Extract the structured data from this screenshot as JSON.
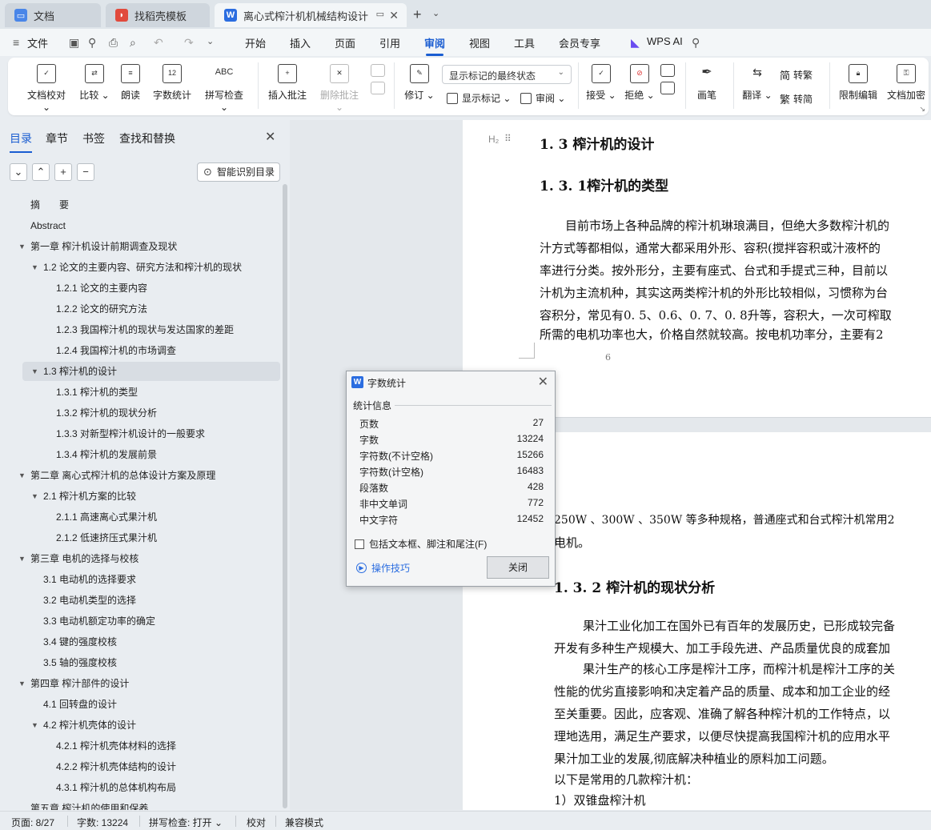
{
  "tabs": [
    {
      "label": "文档",
      "icon": "monitor-icon",
      "active": false
    },
    {
      "label": "找稻壳模板",
      "icon": "docer-icon",
      "active": false
    },
    {
      "label": "离心式榨汁机机械结构设计 说",
      "icon": "wps-word-icon",
      "active": true
    }
  ],
  "menu": {
    "file": "文件",
    "items": [
      "开始",
      "插入",
      "页面",
      "引用",
      "审阅",
      "视图",
      "工具",
      "会员专享"
    ],
    "active": "审阅",
    "wps_ai": "WPS AI"
  },
  "ribbon": {
    "doc_proofread": "文档校对",
    "compare": "比较",
    "read_aloud": "朗读",
    "word_count": "字数统计",
    "spell_check": "拼写检查",
    "insert_comment": "插入批注",
    "delete_comment": "删除批注",
    "revise": "修订",
    "markup_status": "显示标记的最终状态",
    "show_markup": "显示标记",
    "review": "审阅",
    "accept": "接受",
    "reject": "拒绝",
    "pen": "画笔",
    "translate": "翻译",
    "to_traditional": "转繁",
    "to_simplified": "转简",
    "restrict_edit": "限制编辑",
    "doc_encrypt": "文档加密"
  },
  "panel": {
    "tabs": [
      "目录",
      "章节",
      "书签",
      "查找和替换"
    ],
    "active_tab": "目录",
    "smart_toc": "智能识别目录"
  },
  "toc": [
    {
      "text": "摘　　要",
      "level": 1,
      "arrow": false
    },
    {
      "text": "Abstract",
      "level": 1,
      "arrow": false
    },
    {
      "text": "第一章  榨汁机设计前期调查及现状",
      "level": 0,
      "arrow": true
    },
    {
      "text": "1.2 论文的主要内容、研究方法和榨汁机的现状",
      "level": 1.5,
      "arrow": true
    },
    {
      "text": "1.2.1 论文的主要内容",
      "level": 3,
      "arrow": false
    },
    {
      "text": "1.2.2 论文的研究方法",
      "level": 3,
      "arrow": false
    },
    {
      "text": "1.2.3 我国榨汁机的现状与发达国家的差距",
      "level": 3,
      "arrow": false
    },
    {
      "text": "1.2.4 我国榨汁机的市场调查",
      "level": 3,
      "arrow": false
    },
    {
      "text": "1.3  榨汁机的设计",
      "level": 1.5,
      "arrow": true,
      "selected": true
    },
    {
      "text": "1.3.1 榨汁机的类型",
      "level": 3,
      "arrow": false
    },
    {
      "text": "1.3.2  榨汁机的现状分析",
      "level": 3,
      "arrow": false
    },
    {
      "text": "1.3.3 对新型榨汁机设计的一般要求",
      "level": 3,
      "arrow": false
    },
    {
      "text": "1.3.4  榨汁机的发展前景",
      "level": 3,
      "arrow": false
    },
    {
      "text": "第二章  离心式榨汁机的总体设计方案及原理",
      "level": 0,
      "arrow": true
    },
    {
      "text": "2.1  榨汁机方案的比较",
      "level": 1.5,
      "arrow": true
    },
    {
      "text": "2.1.1 高速离心式果汁机",
      "level": 3,
      "arrow": false
    },
    {
      "text": "2.1.2  低速挤压式果汁机",
      "level": 3,
      "arrow": false
    },
    {
      "text": "第三章  电机的选择与校核",
      "level": 0,
      "arrow": true
    },
    {
      "text": "3.1  电动机的选择要求",
      "level": 2,
      "arrow": false
    },
    {
      "text": "3.2  电动机类型的选择",
      "level": 2,
      "arrow": false
    },
    {
      "text": "3.3  电动机额定功率的确定",
      "level": 2,
      "arrow": false
    },
    {
      "text": "3.4  键的强度校核",
      "level": 2,
      "arrow": false
    },
    {
      "text": "3.5  轴的强度校核",
      "level": 2,
      "arrow": false
    },
    {
      "text": "第四章      榨汁部件的设计",
      "level": 0,
      "arrow": true
    },
    {
      "text": "4.1  回转盘的设计",
      "level": 2,
      "arrow": false
    },
    {
      "text": "4.2 榨汁机壳体的设计",
      "level": 1.5,
      "arrow": true
    },
    {
      "text": "4.2.1  榨汁机壳体材料的选择",
      "level": 3,
      "arrow": false
    },
    {
      "text": "4.2.2 榨汁机壳体结构的设计",
      "level": 3,
      "arrow": false
    },
    {
      "text": "4.3.1 榨汁机的总体机构布局",
      "level": 3,
      "arrow": false
    },
    {
      "text": "第五章    榨汁机的使用和保养",
      "level": 0,
      "arrow": false
    }
  ],
  "document": {
    "page1": {
      "h_1_3": "1. 3  榨汁机的设计",
      "h_1_3_1": "1. 3. 1榨汁机的类型",
      "lines": [
        "目前市场上各种品牌的榨汁机琳琅满目，但绝大多数榨汁机的",
        "汁方式等都相似，通常大都采用外形、容积(搅拌容积或汁液杯的",
        "率进行分类。按外形分，主要有座式、台式和手提式三种，目前以",
        "汁机为主流机种，其实这两类榨汁机的外形比较相似，习惯称为台",
        "容积分，常见有0. 5、0.6、0. 7、0. 8升等，容积大，一次可榨取",
        "所需的电机功率也大，价格自然就较高。按电机功率分，主要有2"
      ],
      "page_number": "6",
      "heading_marker": "H₂"
    },
    "page2": {
      "lines_top": [
        "250W  、300W  、350W  等多种规格，普通座式和台式榨汁机常用2",
        "电机。"
      ],
      "h_1_3_2": "1. 3. 2  榨汁机的现状分析",
      "lines": [
        "果汁工业化加工在国外已有百年的发展历史，已形成较完备",
        "开发有多种生产规模大、加工手段先进、产品质量优良的成套加",
        "果汁生产的核心工序是榨汁工序，而榨汁机是榨汁工序的关",
        "性能的优劣直接影响和决定着产品的质量、成本和加工企业的经",
        "至关重要。因此，应客观、准确了解各种榨汁机的工作特点，以",
        "理地选用，满足生产要求，以便尽快提高我国榨汁机的应用水平",
        "果汁加工业的发展,彻底解决种植业的原料加工问题。",
        "以下是常用的几款榨汁机：",
        "1）双锥盘榨汁机"
      ]
    }
  },
  "dialog": {
    "title": "字数统计",
    "group": "统计信息",
    "rows": [
      {
        "label": "页数",
        "value": "27"
      },
      {
        "label": "字数",
        "value": "13224"
      },
      {
        "label": "字符数(不计空格)",
        "value": "15266"
      },
      {
        "label": "字符数(计空格)",
        "value": "16483"
      },
      {
        "label": "段落数",
        "value": "428"
      },
      {
        "label": "非中文单词",
        "value": "772"
      },
      {
        "label": "中文字符",
        "value": "12452"
      }
    ],
    "checkbox": "包括文本框、脚注和尾注(F)",
    "tips": "操作技巧",
    "close": "关闭"
  },
  "status": {
    "page": "页面: 8/27",
    "words": "字数: 13224",
    "spell": "拼写检查: 打开",
    "proof": "校对",
    "compat": "兼容模式"
  }
}
